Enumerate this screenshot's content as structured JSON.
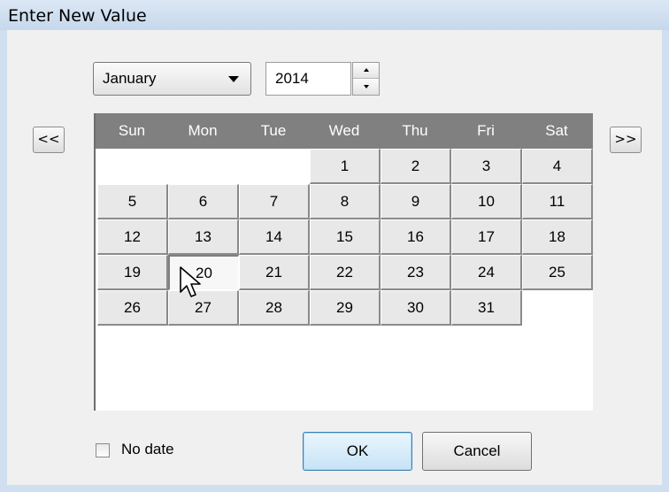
{
  "window": {
    "title": "Enter New Value"
  },
  "picker": {
    "month_selected": "January",
    "year_value": "2014",
    "prev_label": "<<",
    "next_label": ">>"
  },
  "calendar": {
    "day_names": [
      "Sun",
      "Mon",
      "Tue",
      "Wed",
      "Thu",
      "Fri",
      "Sat"
    ],
    "selected_day": "20",
    "weeks": [
      [
        "",
        "",
        "",
        "1",
        "2",
        "3",
        "4"
      ],
      [
        "5",
        "6",
        "7",
        "8",
        "9",
        "10",
        "11"
      ],
      [
        "12",
        "13",
        "14",
        "15",
        "16",
        "17",
        "18"
      ],
      [
        "19",
        "20",
        "21",
        "22",
        "23",
        "24",
        "25"
      ],
      [
        "26",
        "27",
        "28",
        "29",
        "30",
        "31",
        ""
      ]
    ]
  },
  "footer": {
    "no_date_label": "No date",
    "no_date_checked": false,
    "ok_label": "OK",
    "cancel_label": "Cancel"
  },
  "colors": {
    "title_bar": "#cfdff0",
    "calendar_header": "#808080",
    "day_button": "#e8e8e8",
    "ok_border": "#3c7fb1"
  },
  "icons": [
    "dropdown-arrow-icon",
    "spin-up-icon",
    "spin-down-icon",
    "mouse-cursor-icon"
  ]
}
